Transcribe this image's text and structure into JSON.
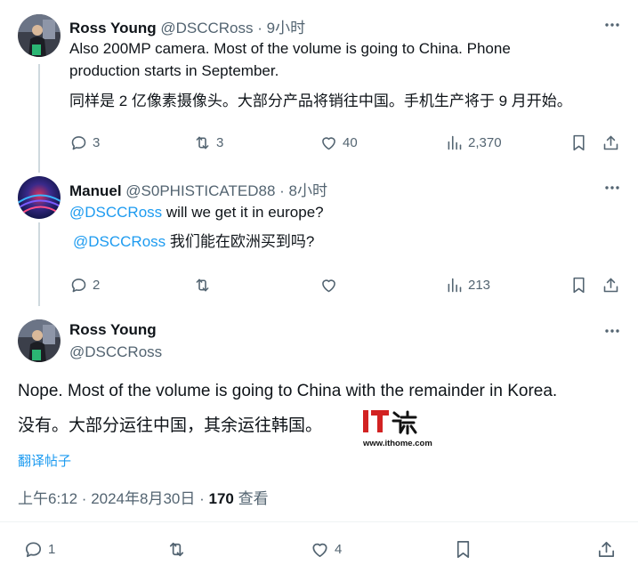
{
  "tweet1": {
    "display_name": "Ross Young",
    "handle": "@DSCCRoss",
    "separator": "·",
    "time": "9小时",
    "text_line1": "Also 200MP camera. Most of the volume is going to China. Phone",
    "text_line2": "production starts in September.",
    "translation": "同样是 2 亿像素摄像头。大部分产品将销往中国。手机生产将于 9 月开始。",
    "replies": "3",
    "retweets": "3",
    "likes": "40",
    "views": "2,370"
  },
  "tweet2": {
    "display_name": "Manuel",
    "handle": "@S0PHISTICATED88",
    "separator": "·",
    "time": "8小时",
    "mention": "@DSCCRoss",
    "text": " will we get it in europe?",
    "translation_mention": "@DSCCRoss",
    "translation": " 我们能在欧洲买到吗?",
    "replies": "2",
    "views": "213"
  },
  "main_tweet": {
    "display_name": "Ross Young",
    "handle": "@DSCCRoss",
    "text": "Nope. Most of the volume is going to China with the remainder in Korea.",
    "translation": "没有。大部分运往中国，其余运往韩国。",
    "translate_link": "翻译帖子",
    "timestamp": "上午6:12 · 2024年8月30日 · ",
    "views_count": "170",
    "views_label": " 查看",
    "replies": "1",
    "likes": "4"
  },
  "watermark": {
    "logo_text": "IT之家",
    "url": "www.ithome.com"
  },
  "colors": {
    "accent": "#1d9bf0",
    "secondary_text": "#536471",
    "primary_text": "#0f1419",
    "thread_line": "#cfd9de",
    "ithome_red": "#d22222"
  },
  "icons": [
    "more-icon",
    "reply-icon",
    "retweet-icon",
    "like-icon",
    "views-icon",
    "bookmark-icon",
    "share-icon"
  ]
}
